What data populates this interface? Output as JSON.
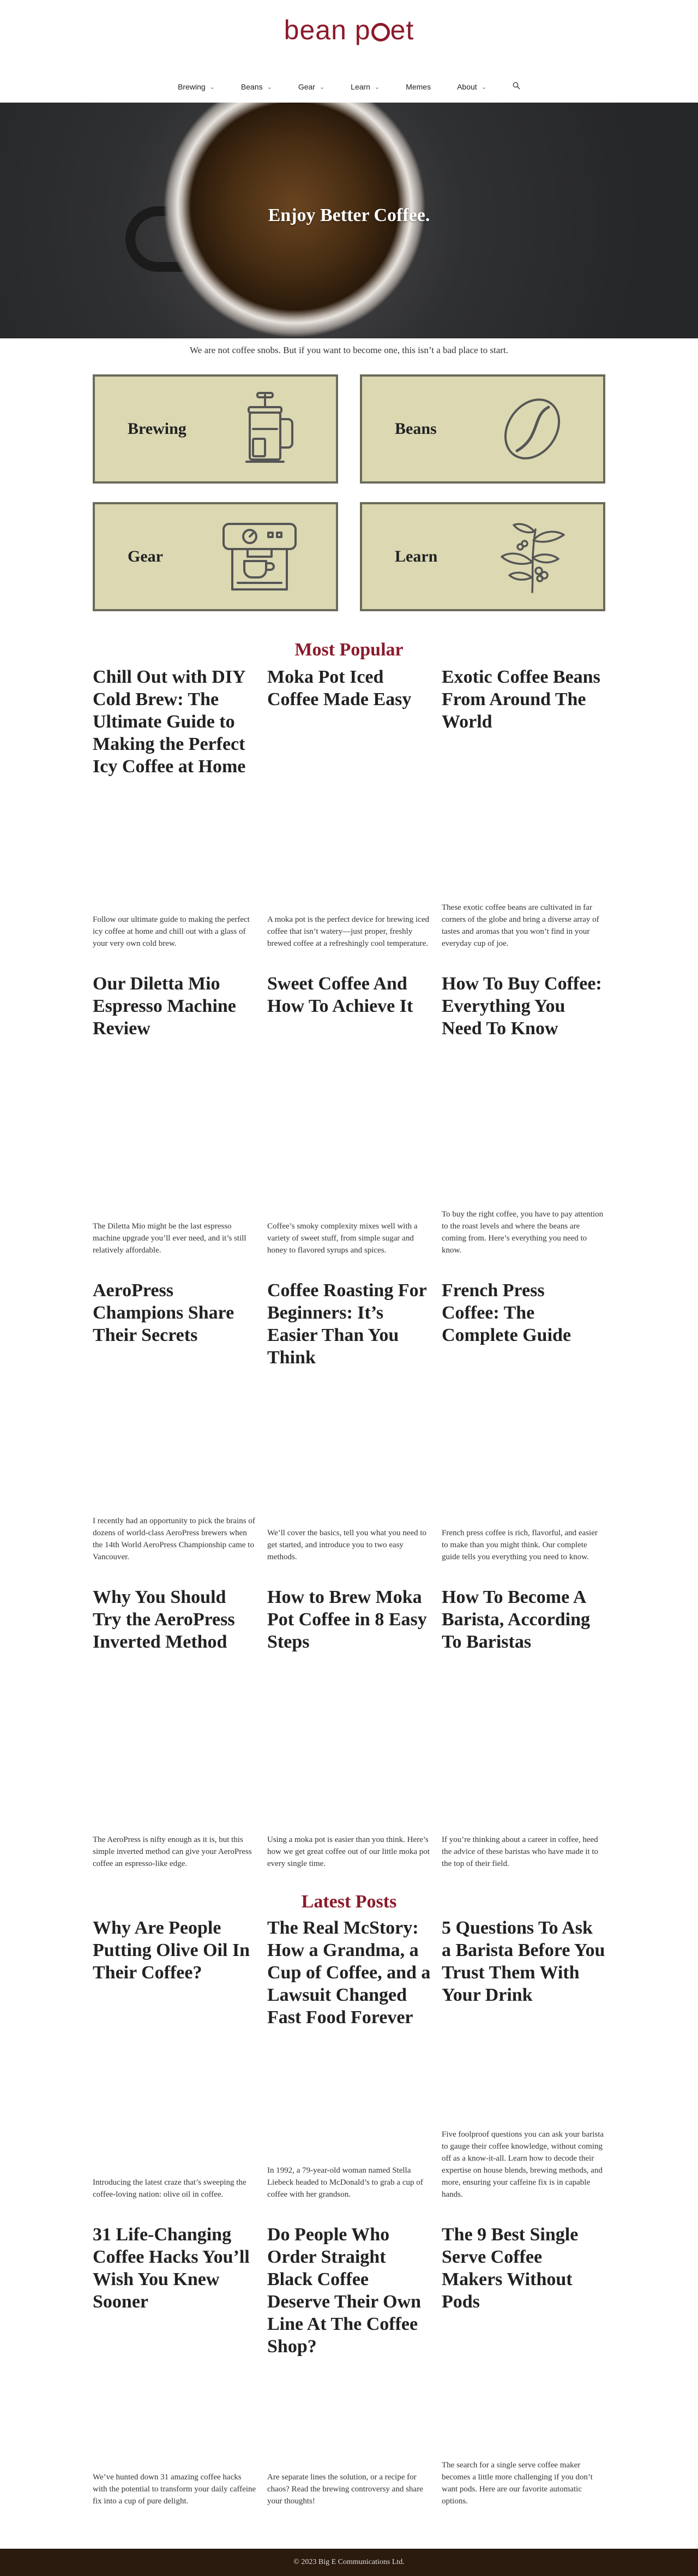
{
  "site": {
    "logo_text_left": "bean p",
    "logo_text_right": "et"
  },
  "nav": {
    "items": [
      {
        "label": "Brewing",
        "has_dropdown": true
      },
      {
        "label": "Beans",
        "has_dropdown": true
      },
      {
        "label": "Gear",
        "has_dropdown": true
      },
      {
        "label": "Learn",
        "has_dropdown": true
      },
      {
        "label": "Memes",
        "has_dropdown": false
      },
      {
        "label": "About",
        "has_dropdown": true
      }
    ],
    "search_icon": "search-icon"
  },
  "hero": {
    "title": "Enjoy Better Coffee."
  },
  "tagline": "We are not coffee snobs. But if you want to become one, this isn’t a bad place to start.",
  "tiles": [
    {
      "label": "Brewing",
      "icon": "french-press-icon"
    },
    {
      "label": "Beans",
      "icon": "coffee-bean-icon"
    },
    {
      "label": "Gear",
      "icon": "espresso-machine-icon"
    },
    {
      "label": "Learn",
      "icon": "coffee-plant-icon"
    }
  ],
  "most_popular": {
    "title": "Most Popular",
    "posts": [
      {
        "title": "Chill Out with DIY Cold Brew: The Ultimate Guide to Making the Perfect Icy Coffee at Home",
        "excerpt": "Follow our ultimate guide to making the perfect icy coffee at home and chill out with a glass of your very own cold brew."
      },
      {
        "title": "Moka Pot Iced Coffee Made Easy",
        "excerpt": "A moka pot is the perfect device for brewing iced coffee that isn’t watery—just proper, freshly brewed coffee at a refreshingly cool temperature."
      },
      {
        "title": "Exotic Coffee Beans From Around The World",
        "excerpt": "These exotic coffee beans are cultivated in far corners of the globe and bring a diverse array of tastes and aromas that you won’t find in your everyday cup of joe."
      },
      {
        "title": "Our Diletta Mio Espresso Machine Review",
        "excerpt": "The Diletta Mio might be the last espresso machine upgrade you’ll ever need, and it’s still relatively affordable."
      },
      {
        "title": "Sweet Coffee And How To Achieve It",
        "excerpt": "Coffee’s smoky complexity mixes well with a variety of sweet stuff, from simple sugar and honey to flavored syrups and spices."
      },
      {
        "title": "How To Buy Coffee: Everything You Need To Know",
        "excerpt": "To buy the right coffee, you have to pay attention to the roast levels and where the beans are coming from. Here’s everything you need to know."
      },
      {
        "title": "AeroPress Champions Share Their Secrets",
        "excerpt": "I recently had an opportunity to pick the brains of dozens of world-class AeroPress brewers when the 14th World AeroPress Championship came to Vancouver."
      },
      {
        "title": "Coffee Roasting For Beginners: It’s Easier Than You Think",
        "excerpt": "We’ll cover the basics, tell you what you need to get started, and introduce you to two easy methods."
      },
      {
        "title": "French Press Coffee: The Complete Guide",
        "excerpt": "French press coffee is rich, flavorful, and easier to make than you might think. Our complete guide tells you everything you need to know."
      },
      {
        "title": "Why You Should Try the AeroPress Inverted Method",
        "excerpt": "The AeroPress is nifty enough as it is, but this simple inverted method can give your AeroPress coffee an espresso-like edge."
      },
      {
        "title": "How to Brew Moka Pot Coffee in 8 Easy Steps",
        "excerpt": "Using a moka pot is easier than you think. Here’s how we get great coffee out of our little moka pot every single time."
      },
      {
        "title": "How To Become A Barista, According To Baristas",
        "excerpt": "If you’re thinking about a career in coffee, heed the advice of these baristas who have made it to the top of their field."
      }
    ]
  },
  "latest_posts": {
    "title": "Latest Posts",
    "posts": [
      {
        "title": "Why Are People Putting Olive Oil In Their Coffee?",
        "excerpt": "Introducing the latest craze that’s sweeping the coffee-loving nation: olive oil in coffee."
      },
      {
        "title": "The Real McStory: How a Grandma, a Cup of Coffee, and a Lawsuit Changed Fast Food Forever",
        "excerpt": "In 1992, a 79-year-old woman named Stella Liebeck headed to McDonald’s to grab a cup of coffee with her grandson."
      },
      {
        "title": "5 Questions To Ask a Barista Before You Trust Them With Your Drink",
        "excerpt": "Five foolproof questions you can ask your barista to gauge their coffee knowledge, without coming off as a know-it-all. Learn how to decode their expertise on house blends, brewing methods, and more, ensuring your caffeine fix is in capable hands."
      },
      {
        "title": "31 Life-Changing Coffee Hacks You’ll Wish You Knew Sooner",
        "excerpt": "We’ve hunted down 31 amazing coffee hacks with the potential to transform your daily caffeine fix into a cup of pure delight."
      },
      {
        "title": "Do People Who Order Straight Black Coffee Deserve Their Own Line At The Coffee Shop?",
        "excerpt": "Are separate lines the solution, or a recipe for chaos? Read the brewing controversy and share your thoughts!"
      },
      {
        "title": "The 9 Best Single Serve Coffee Makers Without Pods",
        "excerpt": "The search for a single serve coffee maker becomes a little more challenging if you don’t want pods. Here are our favorite automatic options."
      }
    ]
  },
  "footer": {
    "text": "© 2023 Big E Communications Ltd."
  },
  "colors": {
    "accent": "#8b1a2b",
    "tile_bg": "#dbd8b2",
    "tile_border": "#6a6a5a",
    "footer_bg": "#2b1a0e"
  }
}
